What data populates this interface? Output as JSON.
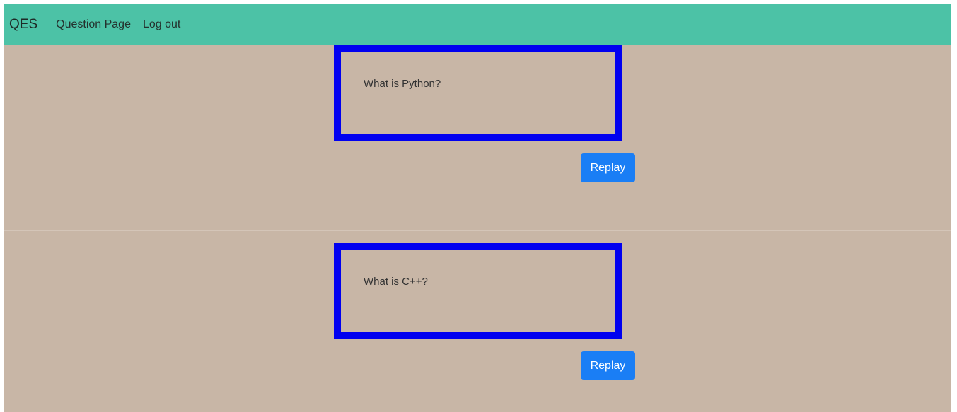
{
  "navbar": {
    "brand": "QES",
    "links": [
      {
        "label": "Question Page"
      },
      {
        "label": "Log out"
      }
    ]
  },
  "questions": [
    {
      "text": "What is Python?",
      "button_label": "Replay"
    },
    {
      "text": "What is C++?",
      "button_label": "Replay"
    }
  ],
  "colors": {
    "navbar_bg": "#4cc2a6",
    "page_bg": "#c8b6a6",
    "box_border": "#0000f0",
    "button_bg": "#1a7ef5"
  }
}
